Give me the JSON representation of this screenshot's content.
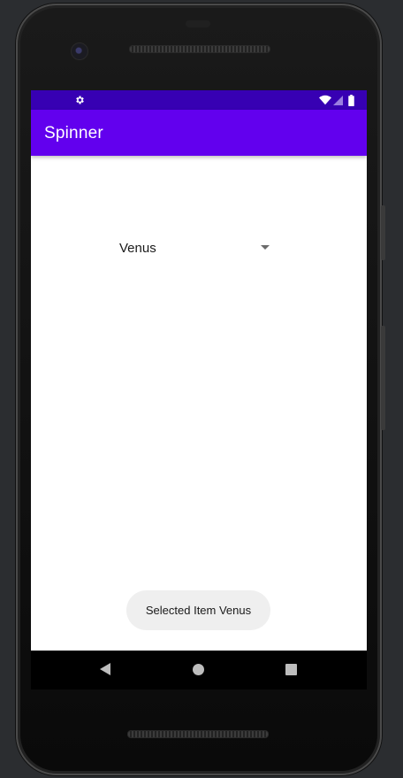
{
  "app": {
    "title": "Spinner"
  },
  "spinner": {
    "selected_value": "Venus"
  },
  "toast": {
    "message": "Selected Item Venus"
  },
  "status_bar": {
    "left_icon": "gear-icon",
    "right_icons": [
      "wifi-icon",
      "signal-icon",
      "battery-icon"
    ]
  },
  "navigation_bar": {
    "buttons": [
      "back-icon",
      "home-icon",
      "recents-icon"
    ]
  },
  "colors": {
    "status_bar": "#3700b3",
    "app_bar": "#6200ee",
    "toast_bg": "#efefef",
    "background": "#ffffff"
  }
}
